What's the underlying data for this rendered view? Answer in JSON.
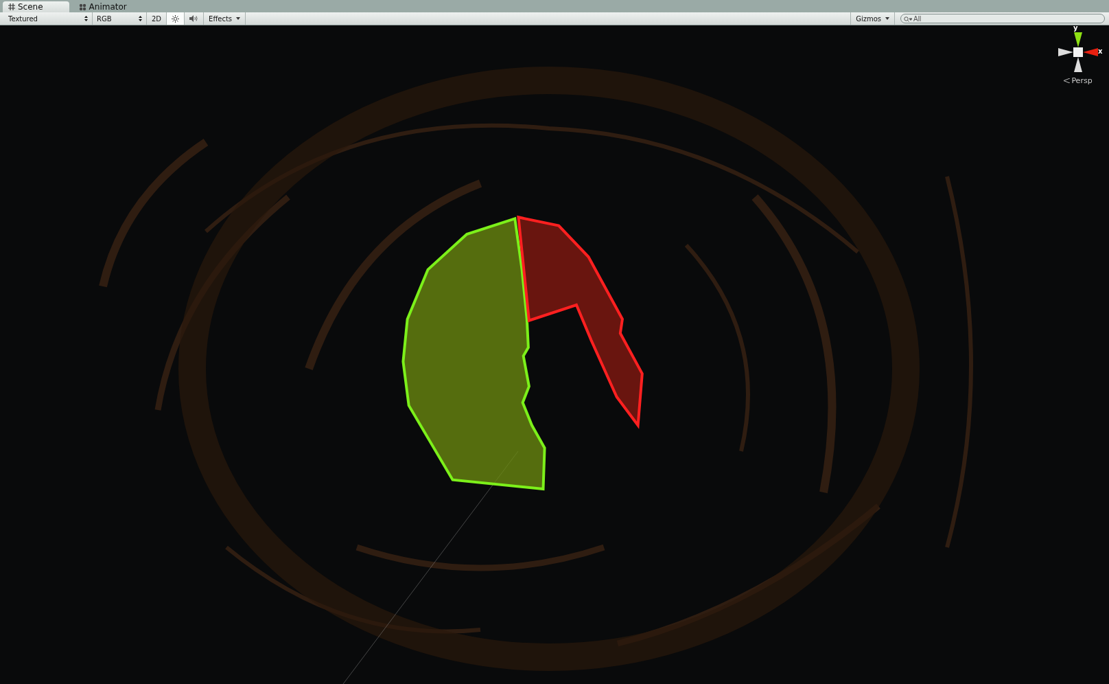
{
  "tabs": [
    {
      "label": "Scene",
      "kind": "grid",
      "selected": true
    },
    {
      "label": "Animator",
      "kind": "nodes",
      "selected": false
    }
  ],
  "toolbar": {
    "items": [
      {
        "kind": "dropdown",
        "label": "Textured"
      },
      {
        "kind": "dropdown",
        "label": "RGB"
      },
      {
        "kind": "toggle",
        "label": "2D",
        "on": false
      },
      {
        "kind": "sun",
        "on": true
      },
      {
        "kind": "audio",
        "on": false
      },
      {
        "kind": "menu",
        "label": "Effects"
      }
    ],
    "gizmos": "Gizmos",
    "search": {
      "placeholder": "All"
    }
  },
  "orientation_gizmo": {
    "y_label": "y",
    "x_label": "x",
    "projection": "Persp"
  }
}
